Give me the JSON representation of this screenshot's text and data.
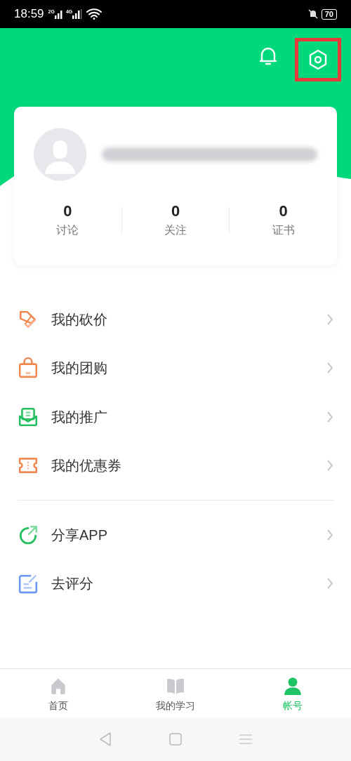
{
  "status_bar": {
    "time": "18:59",
    "network_1": "2G",
    "network_2": "4G",
    "battery": "70"
  },
  "profile": {
    "stats": [
      {
        "value": "0",
        "label": "讨论"
      },
      {
        "value": "0",
        "label": "关注"
      },
      {
        "value": "0",
        "label": "证书"
      }
    ]
  },
  "menu_groups": [
    {
      "items": [
        {
          "label": "我的砍价"
        },
        {
          "label": "我的团购"
        },
        {
          "label": "我的推广"
        },
        {
          "label": "我的优惠券"
        }
      ]
    },
    {
      "items": [
        {
          "label": "分享APP"
        },
        {
          "label": "去评分"
        }
      ]
    }
  ],
  "tab_bar": [
    {
      "label": "首页",
      "selected": false
    },
    {
      "label": "我的学习",
      "selected": false
    },
    {
      "label": "帐号",
      "selected": true
    }
  ]
}
